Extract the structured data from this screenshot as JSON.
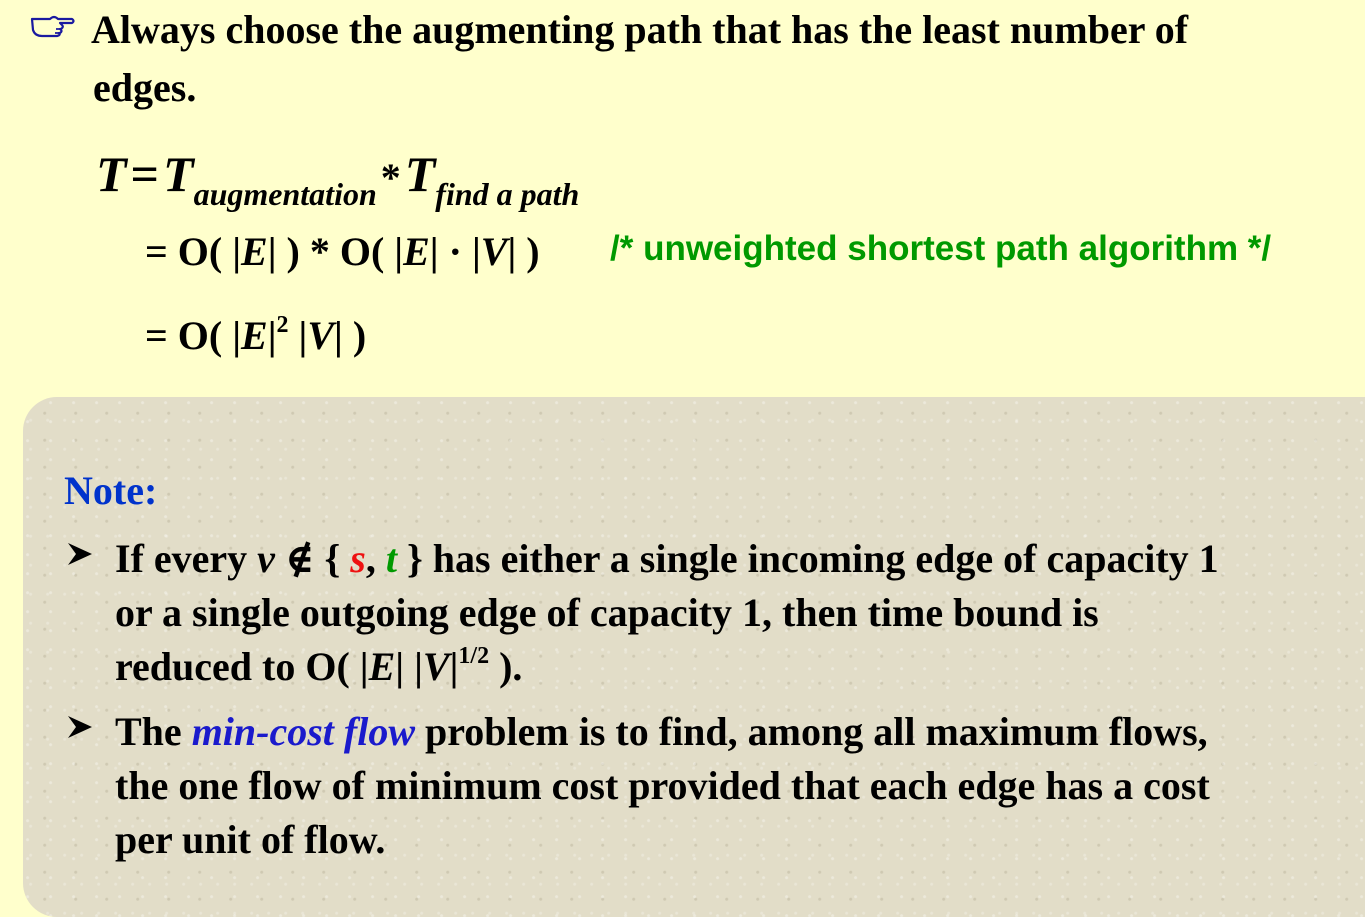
{
  "colors": {
    "background": "#ffffcc",
    "note_box": "#e2ddc8",
    "comment_green": "#009900",
    "note_blue": "#0033cc",
    "highlight_red": "#ee1111",
    "term_blue": "#1a1acc"
  },
  "icons": {
    "main_bullet": "pointing-hand-icon",
    "note_bullet": "arrowhead-bullet-icon"
  },
  "main": {
    "line1": "Always choose the augmenting path that has the least number of",
    "line2": "edges.",
    "formula": {
      "lhs": "T",
      "eq": "=",
      "t1": "T",
      "t1_sub": "augmentation",
      "op": "*",
      "t2": "T",
      "t2_sub": "find a path",
      "line2_a": "= O( |",
      "line2_E1": "E",
      "line2_b": "| ) * O( |",
      "line2_E2": "E",
      "line2_c": "| · |",
      "line2_V": "V",
      "line2_d": "| )",
      "comment": "/* unweighted shortest path algorithm */",
      "line3_a": "= O( |",
      "line3_E": "E",
      "line3_b": "|",
      "line3_sup": "2",
      "line3_c": " |",
      "line3_V": "V",
      "line3_d": "| )"
    }
  },
  "note": {
    "title": "Note:",
    "item1": {
      "p1": "If every ",
      "v": "v",
      "p2": " ∉ { ",
      "s": "s",
      "comma": ", ",
      "t": "t",
      "p3": " } has either a single incoming edge of capacity 1",
      "line2": "or a single outgoing edge of capacity 1, then time bound is",
      "line3_a": "reduced to O( |",
      "line3_E": "E",
      "line3_b": "| |",
      "line3_V": "V",
      "line3_c": "|",
      "line3_sup": "1/2",
      "line3_d": " )."
    },
    "item2": {
      "p1": "The ",
      "term": "min-cost flow",
      "p2": " problem is to find, among all maximum flows,",
      "line2": "the one flow of minimum cost provided that each edge has a cost",
      "line3": "per unit of flow."
    }
  }
}
